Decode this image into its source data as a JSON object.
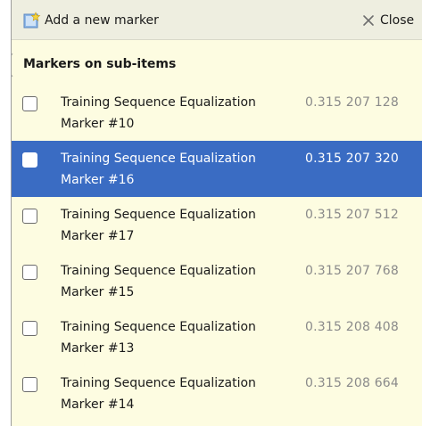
{
  "toolbar": {
    "add_label": "Add a new marker",
    "close_label": "Close"
  },
  "section": {
    "title": "Markers on sub-items"
  },
  "markers": [
    {
      "name": "Training Sequence Equalization",
      "id": "Marker #10",
      "value": "0.315 207 128",
      "selected": false,
      "checked": false
    },
    {
      "name": "Training Sequence Equalization",
      "id": "Marker #16",
      "value": "0.315 207 320",
      "selected": true,
      "checked": false
    },
    {
      "name": "Training Sequence Equalization",
      "id": "Marker #17",
      "value": "0.315 207 512",
      "selected": false,
      "checked": false
    },
    {
      "name": "Training Sequence Equalization",
      "id": "Marker #15",
      "value": "0.315 207 768",
      "selected": false,
      "checked": false
    },
    {
      "name": "Training Sequence Equalization",
      "id": "Marker #13",
      "value": "0.315 208 408",
      "selected": false,
      "checked": false
    },
    {
      "name": "Training Sequence Equalization",
      "id": "Marker #14",
      "value": "0.315 208 664",
      "selected": false,
      "checked": false
    }
  ],
  "colors": {
    "panel_background": "#fdfce1",
    "toolbar_background": "#eeeee0",
    "selection": "#3a6cc3",
    "value_text": "#8a8a8a"
  }
}
